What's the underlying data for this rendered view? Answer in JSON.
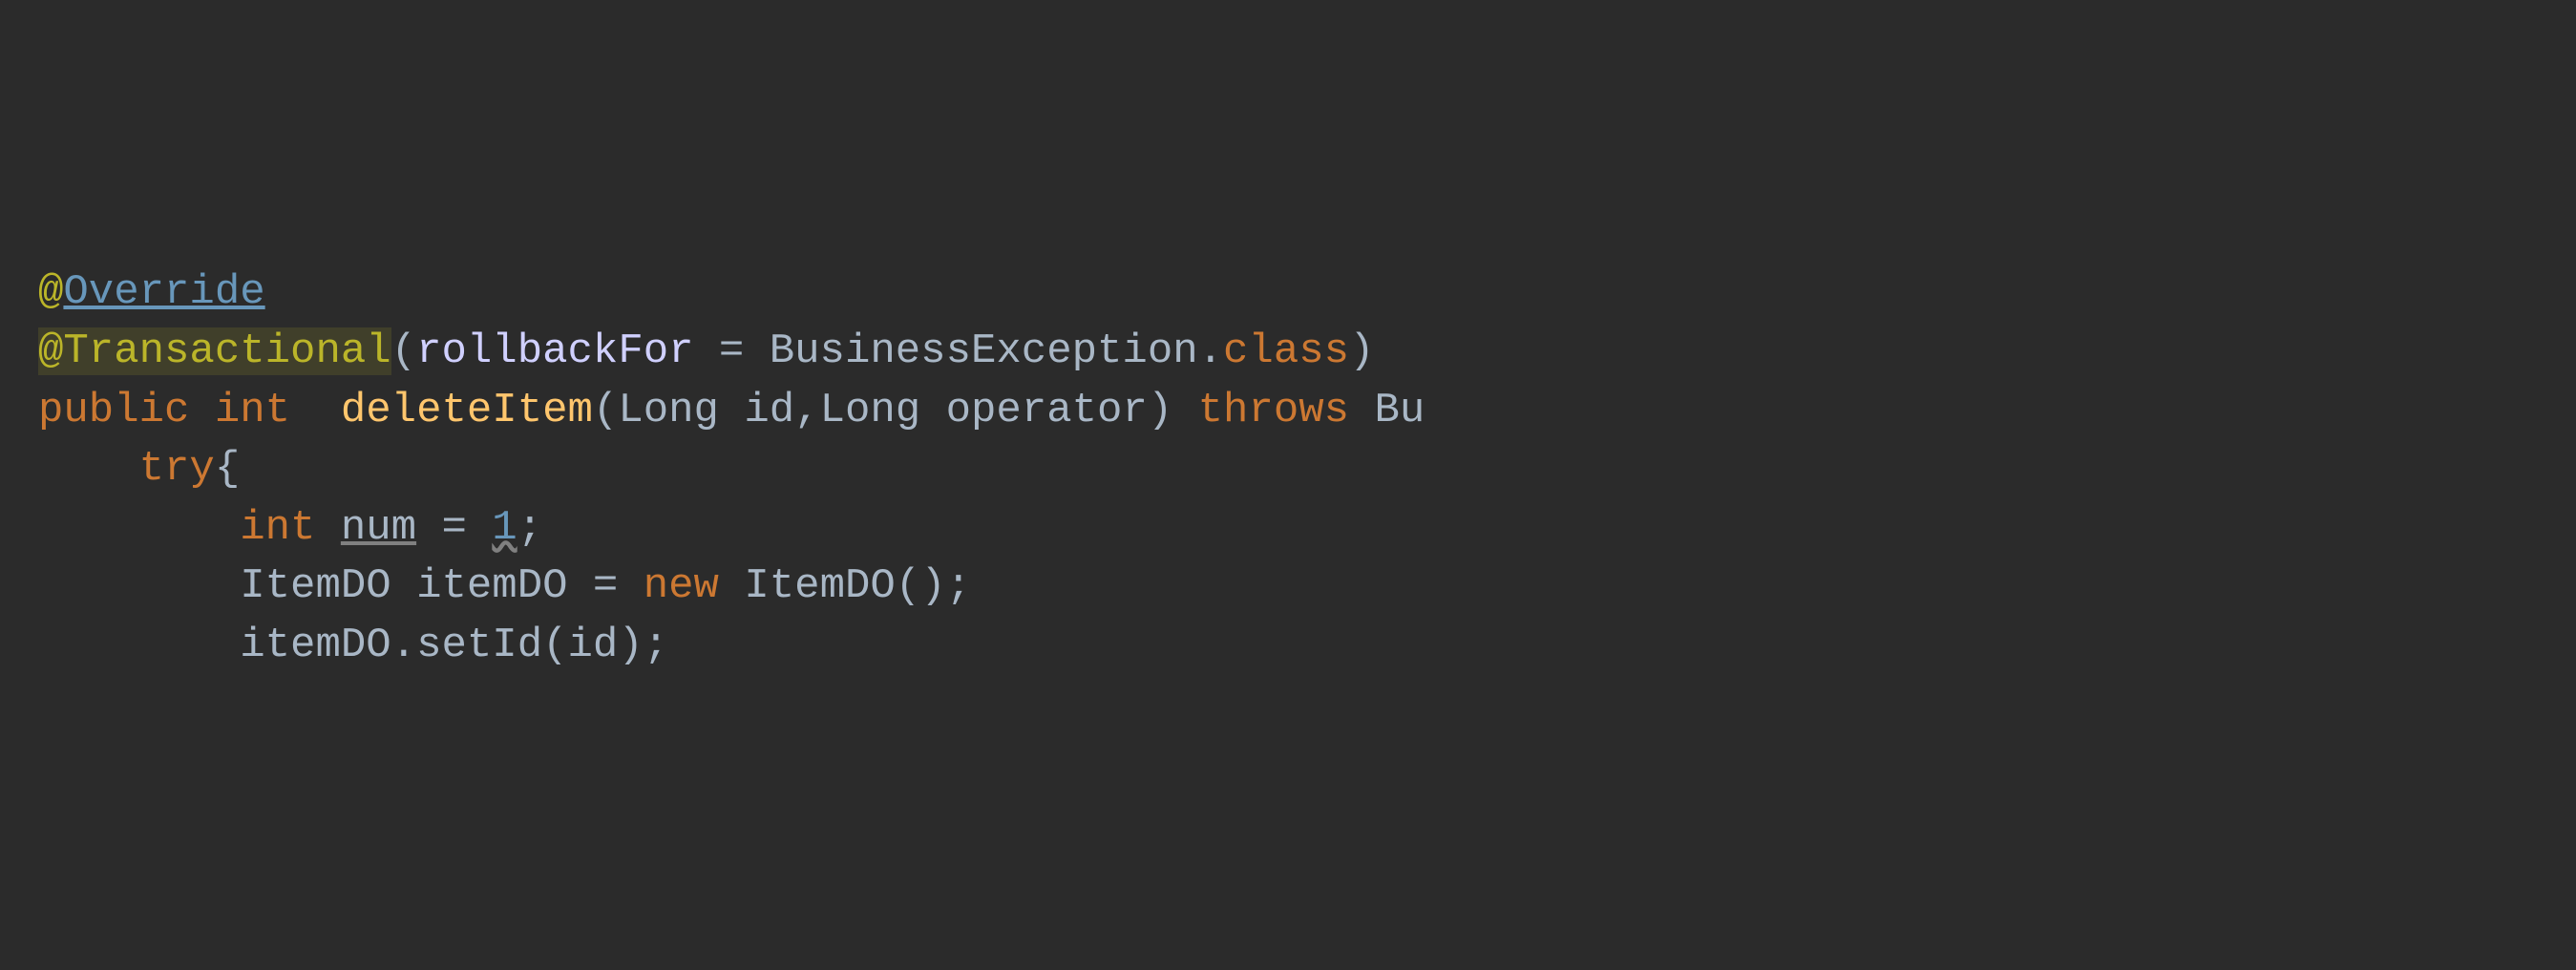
{
  "code": {
    "line1": {
      "at": "@",
      "annotation": "Override"
    },
    "line2": {
      "at": "@",
      "annotation": "Transactional",
      "lparen": "(",
      "attr": "rollbackFor",
      "eq": " = ",
      "value_class": "BusinessException",
      "dot": ".",
      "class_kw": "class",
      "rparen": ")"
    },
    "line3": {
      "modifier": "public",
      "sp1": " ",
      "return_type": "int",
      "sp2": "  ",
      "method": "deleteItem",
      "lparen": "(",
      "param1_type": "Long",
      "sp3": " ",
      "param1_name": "id",
      "comma": ",",
      "param2_type": "Long",
      "sp4": " ",
      "param2_name": "operator",
      "rparen": ")",
      "sp5": " ",
      "throws_kw": "throws",
      "sp6": " ",
      "exception": "Bu"
    },
    "line4": {
      "indent": "    ",
      "try_kw": "try",
      "brace": "{"
    },
    "line5": {
      "indent": "        ",
      "type": "int",
      "sp1": " ",
      "var": "num",
      "sp2": " = ",
      "value": "1",
      "semi": ";"
    },
    "line6": {
      "indent": "        ",
      "type": "ItemDO",
      "sp1": " ",
      "var": "itemDO",
      "sp2": " = ",
      "new_kw": "new",
      "sp3": " ",
      "ctor": "ItemDO",
      "parens": "()",
      "semi": ";"
    },
    "line7": {
      "indent": "        ",
      "obj": "itemDO",
      "dot": ".",
      "method": "setId",
      "lparen": "(",
      "arg": "id",
      "rparen": ")",
      "semi": ";"
    }
  }
}
